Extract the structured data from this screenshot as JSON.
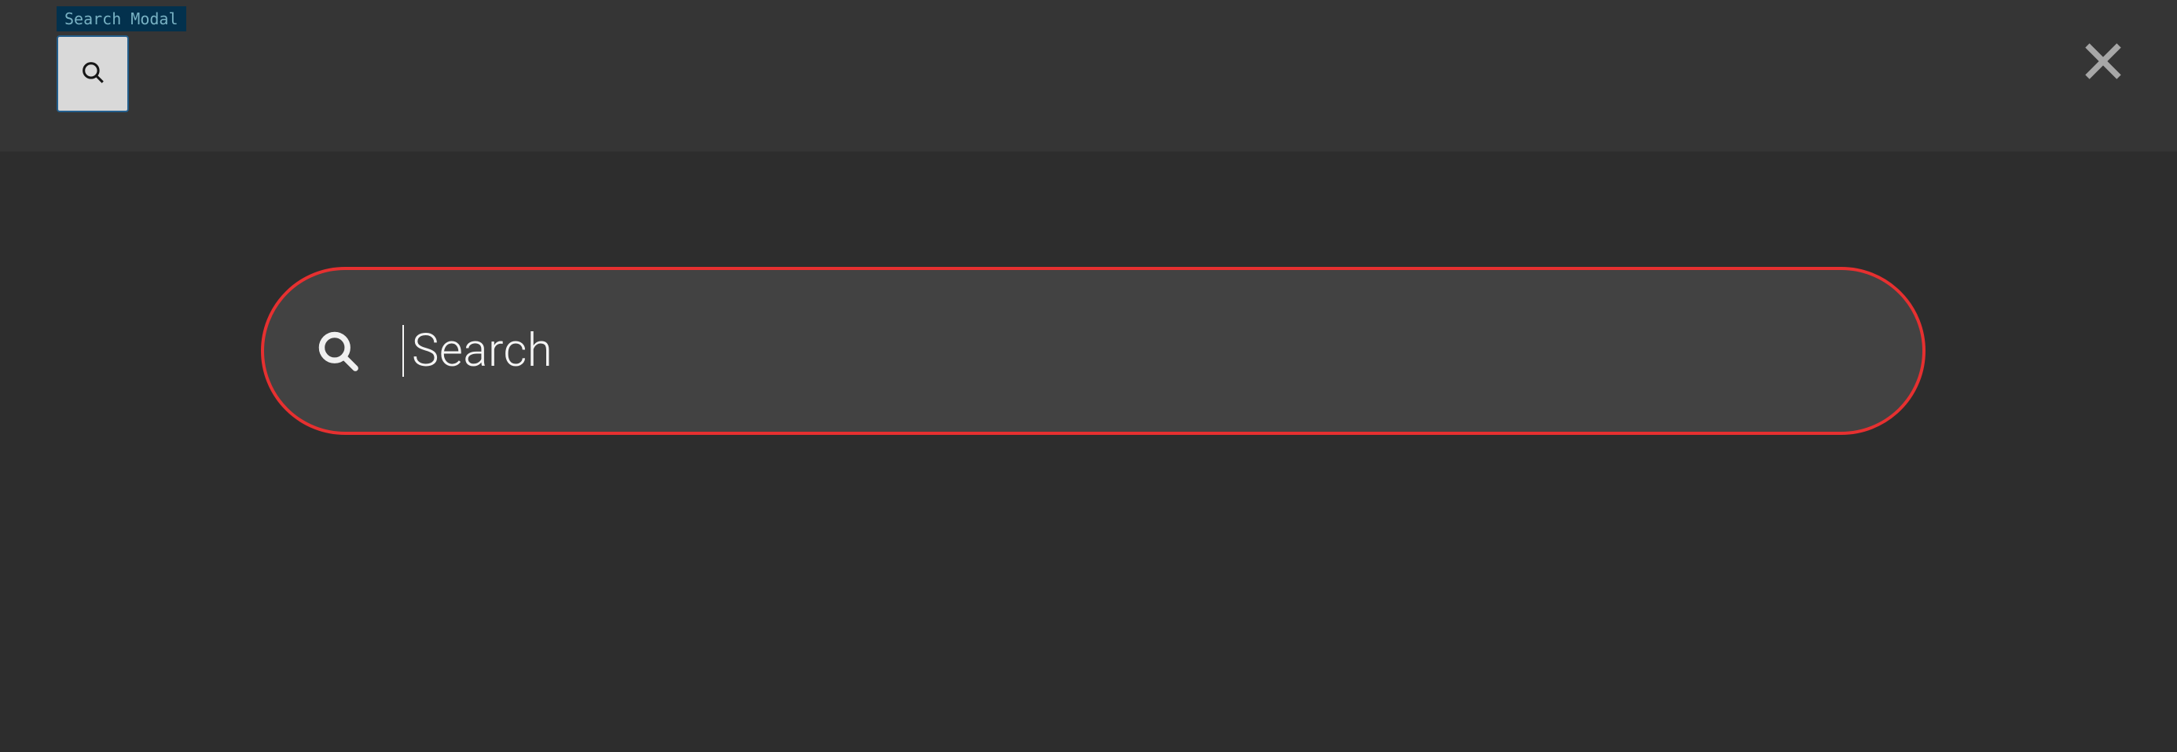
{
  "inspector": {
    "label": "Search Modal",
    "iconName": "search-icon"
  },
  "modal": {
    "closeIconName": "close-icon",
    "search": {
      "placeholder": "Search",
      "value": "",
      "iconName": "search-icon"
    }
  },
  "colors": {
    "accentBorder": "#e63030",
    "modalFieldBg": "#424242",
    "backdrop": "#353535",
    "stripBg": "#3f3f3f",
    "inspectorBg": "#043a5b",
    "inspectorText": "#8ed1e5"
  }
}
